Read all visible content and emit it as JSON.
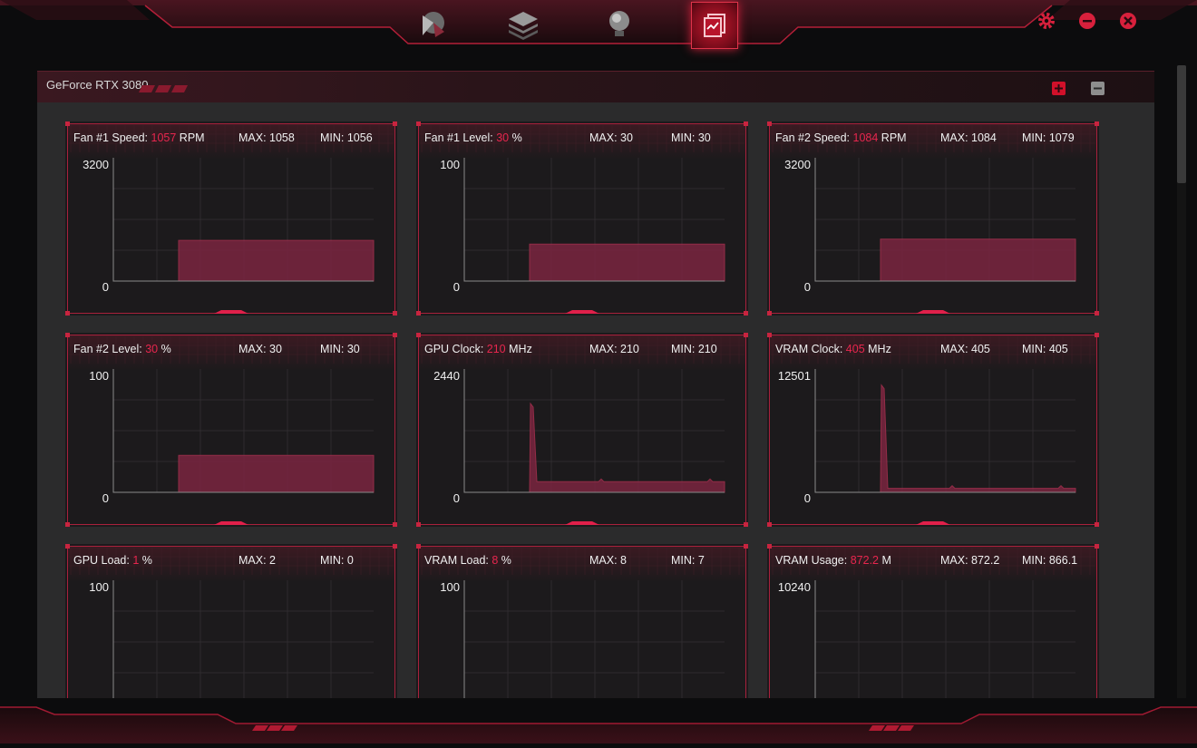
{
  "nav": {
    "items": [
      {
        "name": "gpu-tweak-icon",
        "active": false
      },
      {
        "name": "layers-icon",
        "active": false
      },
      {
        "name": "lightbulb-icon",
        "active": false
      },
      {
        "name": "monitor-chart-icon",
        "active": true
      }
    ]
  },
  "window_controls": [
    "settings-icon",
    "minimize-icon",
    "close-icon"
  ],
  "panel": {
    "title": "GeForce RTX 3080"
  },
  "colors": {
    "accent": "#e8264e",
    "frame": "#c8243f",
    "fill": "#7a2540"
  },
  "cards": [
    {
      "label": "Fan #1 Speed",
      "value": "1057",
      "unit": "RPM",
      "max": "MAX: 1058",
      "min": "MIN: 1056",
      "ymax": "3200",
      "ymin": "0",
      "series": {
        "type": "step",
        "start": 0.25,
        "level": 0.33
      }
    },
    {
      "label": "Fan #1 Level",
      "value": "30",
      "unit": "%",
      "max": "MAX: 30",
      "min": "MIN: 30",
      "ymax": "100",
      "ymin": "0",
      "series": {
        "type": "step",
        "start": 0.25,
        "level": 0.3
      }
    },
    {
      "label": "Fan #2 Speed",
      "value": "1084",
      "unit": "RPM",
      "max": "MAX: 1084",
      "min": "MIN: 1079",
      "ymax": "3200",
      "ymin": "0",
      "series": {
        "type": "step",
        "start": 0.25,
        "level": 0.34
      }
    },
    {
      "label": "Fan #2 Level",
      "value": "30",
      "unit": "%",
      "max": "MAX: 30",
      "min": "MIN: 30",
      "ymax": "100",
      "ymin": "0",
      "series": {
        "type": "step",
        "start": 0.25,
        "level": 0.3
      }
    },
    {
      "label": "GPU Clock",
      "value": "210",
      "unit": "MHz",
      "max": "MAX: 210",
      "min": "MIN: 210",
      "ymax": "2440",
      "ymin": "0",
      "series": {
        "type": "spike",
        "start": 0.25,
        "peak": 0.72,
        "level": 0.086
      }
    },
    {
      "label": "VRAM Clock",
      "value": "405",
      "unit": "MHz",
      "max": "MAX: 405",
      "min": "MIN: 405",
      "ymax": "12501",
      "ymin": "0",
      "series": {
        "type": "spike",
        "start": 0.25,
        "peak": 0.87,
        "level": 0.032
      }
    },
    {
      "label": "GPU Load",
      "value": "1",
      "unit": "%",
      "max": "MAX: 2",
      "min": "MIN: 0",
      "ymax": "100",
      "ymin": "",
      "series": {
        "type": "none"
      }
    },
    {
      "label": "VRAM Load",
      "value": "8",
      "unit": "%",
      "max": "MAX: 8",
      "min": "MIN: 7",
      "ymax": "100",
      "ymin": "",
      "series": {
        "type": "none"
      }
    },
    {
      "label": "VRAM Usage",
      "value": "872.2",
      "unit": "M",
      "max": "MAX: 872.2",
      "min": "MIN: 866.1",
      "ymax": "10240",
      "ymin": "",
      "series": {
        "type": "none"
      }
    }
  ]
}
